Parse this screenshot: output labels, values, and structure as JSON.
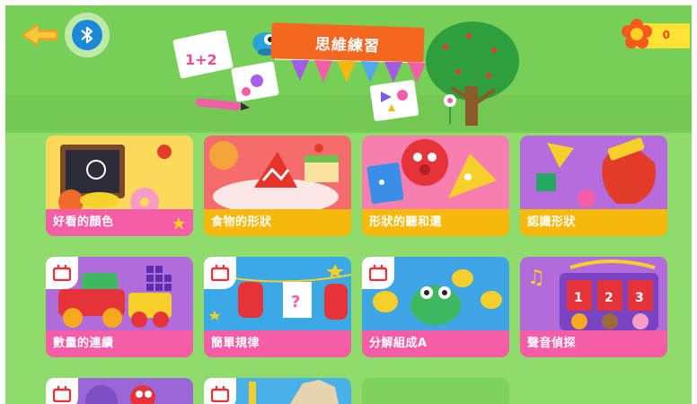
{
  "header": {
    "title": "思維練習",
    "score": "0"
  },
  "cards": [
    {
      "label": "好看的顏色",
      "locked": false,
      "starred": true
    },
    {
      "label": "食物的形狀",
      "locked": false,
      "starred": false
    },
    {
      "label": "形狀的聽和還",
      "locked": false,
      "starred": false
    },
    {
      "label": "認識形狀",
      "locked": false,
      "starred": false
    },
    {
      "label": "數量的連續",
      "locked": true,
      "starred": false
    },
    {
      "label": "簡單規律",
      "locked": true,
      "starred": false
    },
    {
      "label": "分解組成A",
      "locked": true,
      "starred": false
    },
    {
      "label": "聲音偵探",
      "locked": false,
      "starred": false
    }
  ],
  "colors": {
    "background": "#8fdc6c",
    "label_yellow": "#f6b90b",
    "label_pink": "#f55ea7",
    "banner": "#f5661f",
    "accent_score": "#ffe233"
  },
  "icons": [
    "back-arrow-icon",
    "bluetooth-icon",
    "flower-icon",
    "lock-icon",
    "star-icon"
  ]
}
